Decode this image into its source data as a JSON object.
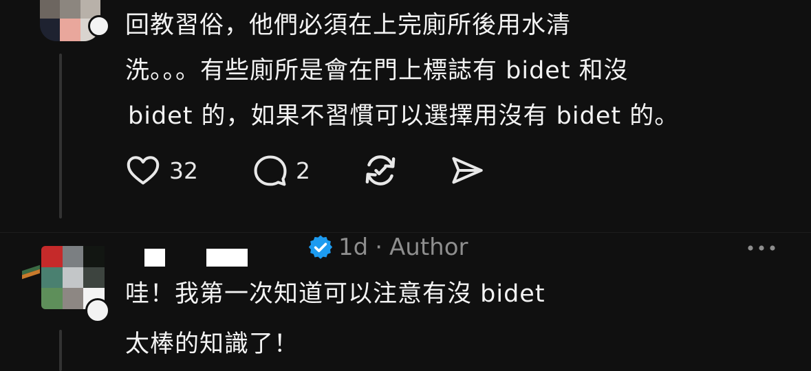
{
  "post": {
    "body_lines": [
      "回教習俗，他們必須在上完廁所後用水清",
      "洗。。。有些廁所是會在門上標誌有 bidet 和沒",
      "bidet 的，如果不習慣可以選擇用沒有 bidet 的。"
    ],
    "actions": {
      "like_icon": "heart-icon",
      "like_count": "32",
      "reply_icon": "comment-icon",
      "reply_count": "2",
      "repost_icon": "repost-icon",
      "share_icon": "send-icon"
    }
  },
  "reply": {
    "verified_icon": "verified-badge-icon",
    "time": "1d",
    "separator": "·",
    "author_label": "Author",
    "more_icon": "more-icon",
    "body_lines": [
      "哇！我第一次知道可以注意有沒 bidet",
      "太棒的知識了！"
    ]
  },
  "colors": {
    "background": "#101010",
    "text": "#f3f3f3",
    "muted": "#8e8e8e",
    "verified": "#1d9bf0"
  }
}
